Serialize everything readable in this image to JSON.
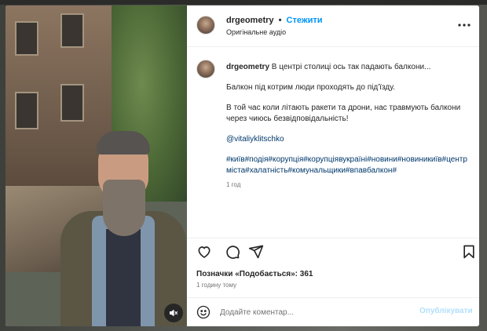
{
  "post": {
    "username": "drgeometry",
    "separator": "•",
    "follow_label": "Стежити",
    "audio_label": "Оригінальне аудіо",
    "more_icon": "more-horizontal-icon"
  },
  "caption": {
    "username": "drgeometry",
    "text1": "В центрі столиці ось так падають балкони...",
    "text2": "Балкон під котрим люди проходять до під'їзду.",
    "text3": "В той час коли літають ракети та дрони, нас травмують балкони через чиюсь безвідповідальність!",
    "mention": "@vitaliyklitschko",
    "hashtags": "#київ#подія#корупція#корупціявукраїні#новини#новиникиїв#центрміста#халатність#комунальщики#впавбалкон#",
    "time": "1 год"
  },
  "actions": {
    "like_icon": "heart-icon",
    "comment_icon": "comment-icon",
    "share_icon": "send-icon",
    "save_icon": "bookmark-icon"
  },
  "likes_text": "Позначки «Подобається»: 361",
  "posted_time": "1 годину тому",
  "comment": {
    "placeholder": "Додайте коментар...",
    "post_label": "Опублікувати"
  },
  "media": {
    "mute_icon": "speaker-muted-icon"
  },
  "colors": {
    "link": "#00376b",
    "follow": "#0095f6",
    "post_disabled": "#b2dffc",
    "secondary_text": "#737373"
  }
}
